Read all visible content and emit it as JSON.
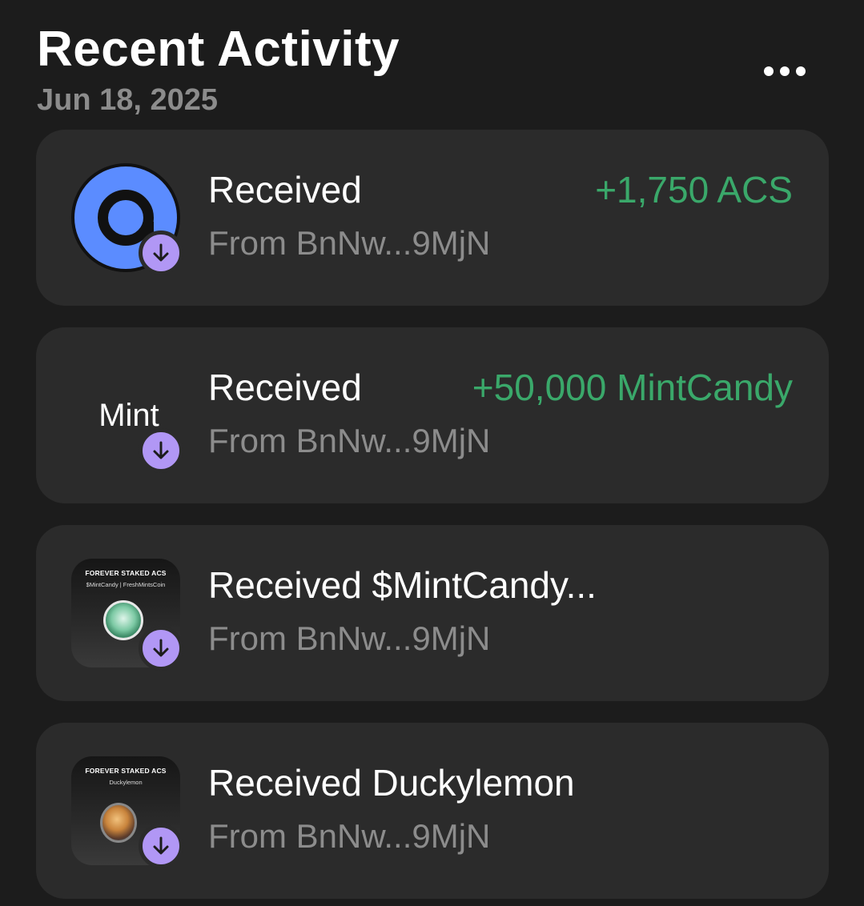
{
  "header": {
    "title": "Recent Activity",
    "date": "Jun 18, 2025"
  },
  "more_icon": "more-horizontal-icon",
  "colors": {
    "background": "#1c1c1c",
    "card": "#2b2b2b",
    "positive_amount": "#3aa86a",
    "badge": "#b197f5",
    "muted_text": "#8c8c8c"
  },
  "activities": [
    {
      "title": "Received",
      "amount": "+1,750 ACS",
      "from": "From BnNw...9MjN",
      "icon": "acs-token-logo",
      "badge_icon": "arrow-down-icon"
    },
    {
      "title": "Received",
      "amount": "+50,000 MintCandy",
      "from": "From BnNw...9MjN",
      "icon_text": "Mint",
      "badge_icon": "arrow-down-icon"
    },
    {
      "title": "Received $MintCandy...",
      "from": "From BnNw...9MjN",
      "nft_heading": "FOREVER STAKED ACS",
      "nft_subheading": "$MintCandy | FreshMintsCoin",
      "badge_icon": "arrow-down-icon"
    },
    {
      "title": "Received Duckylemon",
      "from": "From BnNw...9MjN",
      "nft_heading": "FOREVER STAKED ACS",
      "nft_subheading": "Duckylemon",
      "badge_icon": "arrow-down-icon"
    }
  ]
}
